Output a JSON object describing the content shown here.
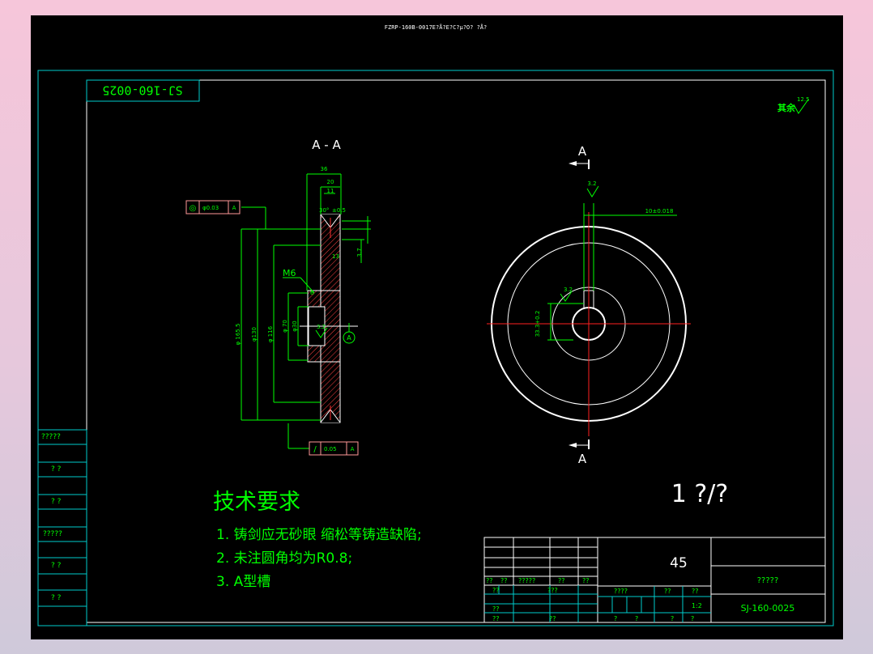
{
  "window_title": "FZRP-160B-0017E?Å?E?C?µ?O? ?Å?",
  "drawing_number_stamp": "SJ-160-0025",
  "roughness_other": {
    "label": "其余",
    "value": "12.5"
  },
  "section_view": {
    "label": "A - A",
    "dims": {
      "width_36": "36",
      "width_20": "20",
      "width_11": "11",
      "angle_label": "30°",
      "angle_tol": "±0.5",
      "small_4": "4",
      "small_6": "6",
      "dim_13": "13",
      "dim_37": "3.7",
      "dia_outer": "φ 165.5",
      "dia_130": "φ130",
      "dia_116": "φ 116",
      "dia_70": "φ 70",
      "dia_30": "φ30",
      "m6": "M6",
      "rough_32": "3.2"
    },
    "datum_label": "A",
    "fcf_top": {
      "symbol": "◎",
      "value": "φ0.03",
      "datum": "A"
    },
    "fcf_bottom": {
      "symbol": "/",
      "value": "0.05",
      "datum": "A"
    }
  },
  "front_view": {
    "cut_label_top": "A",
    "cut_label_bottom": "A",
    "keyway_width": "10±0.018",
    "keyway_depth": "33.3+0.2",
    "rough_top": "3.2",
    "rough_side": "3.2"
  },
  "scale_text": "1 ?/?",
  "tech_requirements": {
    "title": "技术要求",
    "items": [
      "1. 铸剑应无砂眼 缩松等铸造缺陷;",
      "2. 未注圆角均为R0.8;",
      "3. A型槽"
    ]
  },
  "side_panel": [
    "?????",
    "? ?",
    "? ?",
    "?????",
    "? ?",
    "? ?"
  ],
  "title_block": {
    "material": "45",
    "row_a": [
      "??",
      "??",
      "?????",
      "??",
      "??"
    ],
    "row_b": [
      "??",
      "???"
    ],
    "row_c": [
      "??"
    ],
    "row_d": [
      "??",
      "??"
    ],
    "mid_header": [
      "????",
      "??",
      "??"
    ],
    "scale_cell": "1:2",
    "mid_bottom": [
      "?",
      "?",
      "?",
      "?"
    ],
    "company": "?????",
    "drawing_no": "SJ-160-0025"
  }
}
